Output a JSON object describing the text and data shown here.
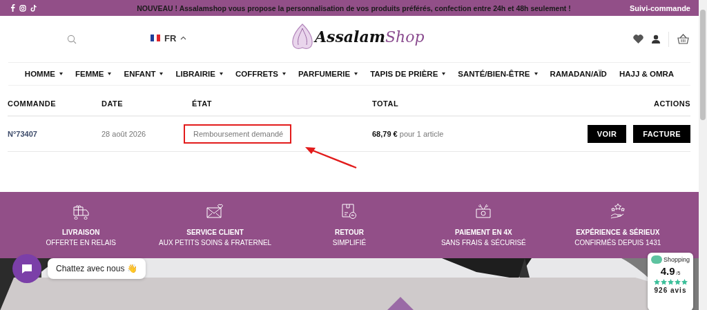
{
  "announcement_bar": {
    "message": "NOUVEAU ! Assalamshop vous propose la personnalisation de vos produits préférés, confection entre 24h et 48h seulement !",
    "link": "Suivi-commande"
  },
  "header": {
    "language": "FR",
    "logo": {
      "part_1": "Assalam",
      "part_2": "Shop"
    }
  },
  "nav": [
    {
      "label": "HOMME",
      "has_dropdown": true
    },
    {
      "label": "FEMME",
      "has_dropdown": true
    },
    {
      "label": "ENFANT",
      "has_dropdown": true
    },
    {
      "label": "LIBRAIRIE",
      "has_dropdown": true
    },
    {
      "label": "COFFRETS",
      "has_dropdown": true
    },
    {
      "label": "PARFUMERIE",
      "has_dropdown": true
    },
    {
      "label": "TAPIS DE PRIÈRE",
      "has_dropdown": true
    },
    {
      "label": "SANTÉ/BIEN-ÊTRE",
      "has_dropdown": true
    },
    {
      "label": "RAMADAN/AÏD",
      "has_dropdown": false
    },
    {
      "label": "HAJJ & OMRA",
      "has_dropdown": false
    }
  ],
  "orders_table": {
    "columns": [
      "COMMANDE",
      "DATE",
      "ÉTAT",
      "TOTAL",
      "ACTIONS"
    ],
    "rows": [
      {
        "order": "N°73407",
        "date": "28 août 2026",
        "status": "Remboursement demandé",
        "status_highlighted": true,
        "total": "68,79 €",
        "total_note": "pour 1 article",
        "actions": [
          "VOIR",
          "FACTURE"
        ]
      }
    ]
  },
  "features": [
    {
      "kind": "delivery",
      "title": "LIVRAISON",
      "subtitle": "OFFERTE EN RELAIS"
    },
    {
      "kind": "mail",
      "title": "SERVICE CLIENT",
      "subtitle": "AUX PETITS SOINS & FRATERNEL"
    },
    {
      "kind": "return",
      "title": "RETOUR",
      "subtitle": "SIMPLIFIÉ"
    },
    {
      "kind": "payment",
      "title": "PAIEMENT EN 4X",
      "subtitle": "SANS FRAIS & SÉCURISÉ"
    },
    {
      "kind": "stars",
      "title": "EXPÉRIENCE & SÉRIEUX",
      "subtitle": "CONFIRMÉS DEPUIS 1431"
    }
  ],
  "chat": {
    "label": "Chattez avec nous 👋"
  },
  "rating_widget": {
    "brand": "Shopping",
    "score": "4.9",
    "scale": "/5",
    "stars": 5,
    "reviews": "926 avis"
  }
}
